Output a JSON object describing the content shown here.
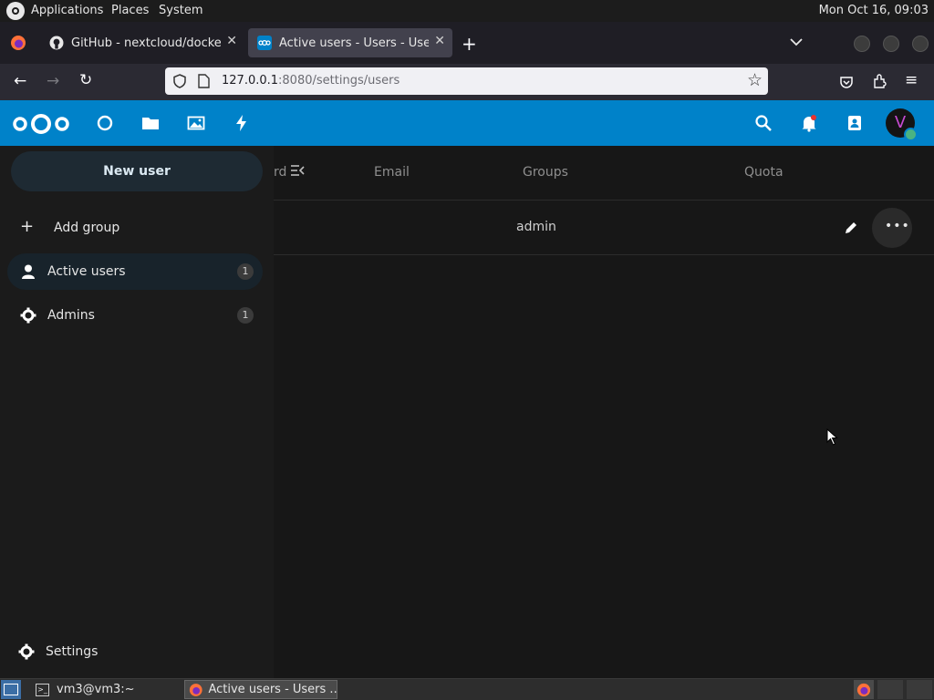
{
  "topbar": {
    "menus": [
      "Applications",
      "Places",
      "System"
    ],
    "clock": "Mon Oct 16, 09:03"
  },
  "tabs": [
    {
      "title": "GitHub - nextcloud/docker: ",
      "icon": "github-icon"
    },
    {
      "title": "Active users - Users - Users",
      "icon": "nextcloud-icon",
      "active": true
    }
  ],
  "url": {
    "host": "127.0.0.1",
    "rest": ":8080/settings/users"
  },
  "nav": {
    "new_user": "New user",
    "add_group": "Add group",
    "groups": [
      {
        "label": "Active users",
        "count": "1",
        "icon": "user-icon",
        "active": true
      },
      {
        "label": "Admins",
        "count": "1",
        "icon": "gear-icon"
      }
    ],
    "settings": "Settings"
  },
  "table": {
    "header_partial": "rd",
    "columns": {
      "email": "Email",
      "groups": "Groups",
      "quota": "Quota"
    },
    "rows": [
      {
        "groups": "admin"
      }
    ]
  },
  "avatar_initial": "V",
  "taskbar": {
    "items": [
      "vm3@vm3:~",
      "Active users - Users ..."
    ]
  },
  "colors": {
    "header": "#0082c9",
    "background": "#171717",
    "nav": "#1b1b1b"
  }
}
